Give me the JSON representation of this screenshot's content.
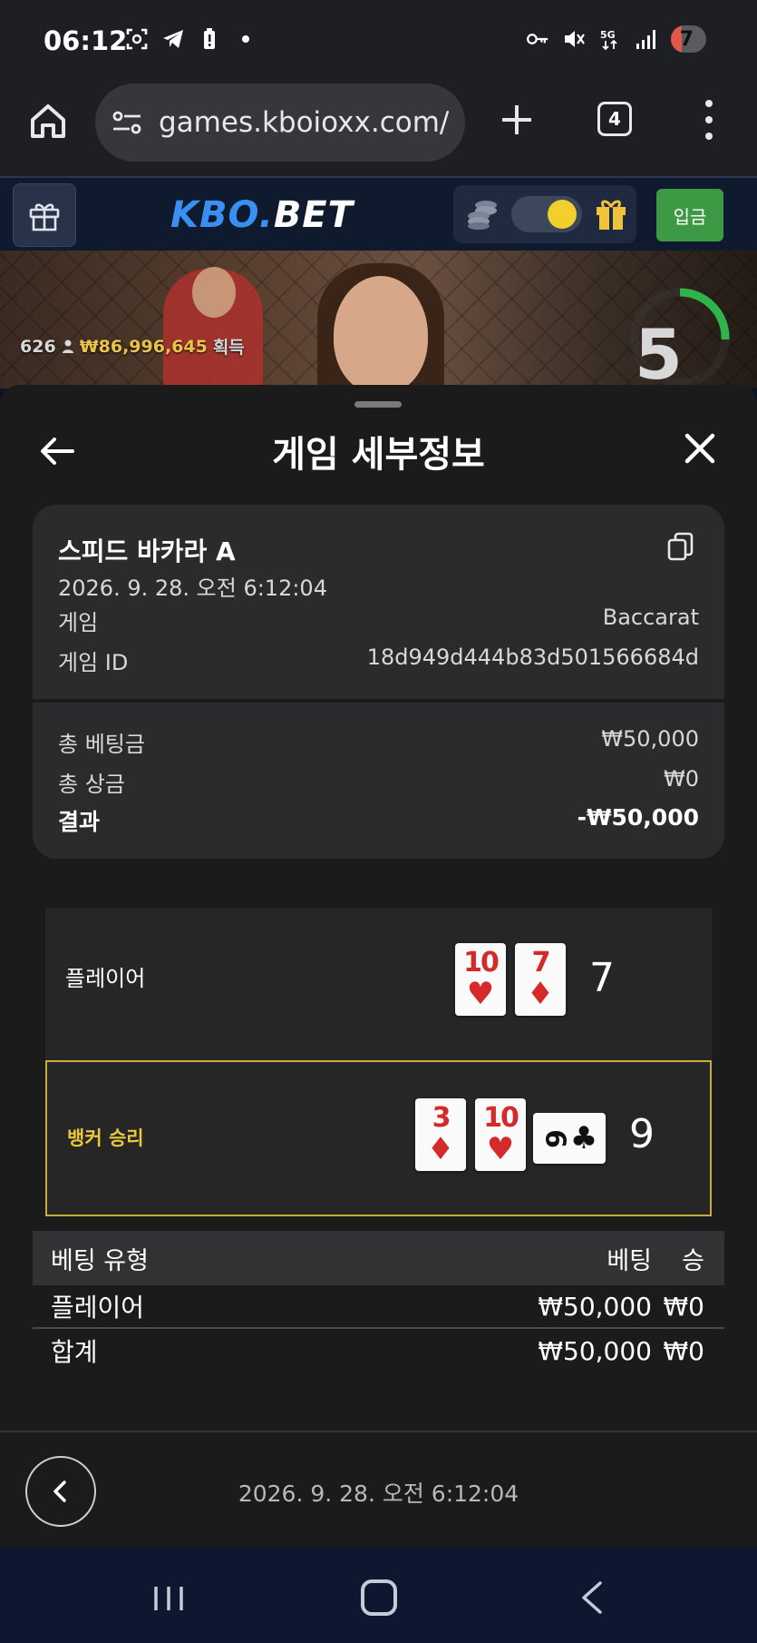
{
  "status_bar": {
    "time": "06:12",
    "battery": "7"
  },
  "browser": {
    "url": "games.kboioxx.com/",
    "tab_count": "4"
  },
  "site": {
    "brand_main": "KBO",
    "brand_dot": ".",
    "brand_bet": "BET",
    "deposit_label": "입금"
  },
  "video": {
    "players": "626",
    "amount": "₩86,996,645",
    "amount_suffix": "획득",
    "countdown": "5"
  },
  "sheet": {
    "title": "게임 세부정보",
    "card_title": "스피드 바카라 A",
    "date": "2026. 9. 28. 오전 6:12:04",
    "game_label": "게임",
    "game_value": "Baccarat",
    "game_id_label": "게임 ID",
    "game_id_value": "18d949d444b83d501566684d",
    "total_bet_label": "총 베팅금",
    "total_bet_value": "₩50,000",
    "total_win_label": "총 상금",
    "total_win_value": "₩0",
    "result_label": "결과",
    "result_value": "-₩50,000"
  },
  "hands": {
    "player": {
      "label": "플레이어",
      "score": "7",
      "cards": [
        {
          "rank": "10",
          "suit": "♥"
        },
        {
          "rank": "7",
          "suit": "♦"
        }
      ]
    },
    "banker": {
      "label": "뱅커 승리",
      "score": "9",
      "cards": [
        {
          "rank": "3",
          "suit": "♦"
        },
        {
          "rank": "10",
          "suit": "♥"
        },
        {
          "rank": "6",
          "suit": "♣"
        }
      ]
    }
  },
  "bet_table": {
    "headers": [
      "베팅 유형",
      "베팅",
      "승"
    ],
    "rows": [
      {
        "type": "플레이어",
        "bet": "₩50,000",
        "win": "₩0"
      }
    ],
    "total": {
      "type": "합계",
      "bet": "₩50,000",
      "win": "₩0"
    }
  },
  "footer": {
    "date": "2026. 9. 28. 오전 6:12:04"
  },
  "colors": {
    "brand_blue": "#3a8ff2",
    "deposit_green": "#3c9a45",
    "win_gold": "#e9c93a",
    "card_red": "#d42a2a"
  }
}
